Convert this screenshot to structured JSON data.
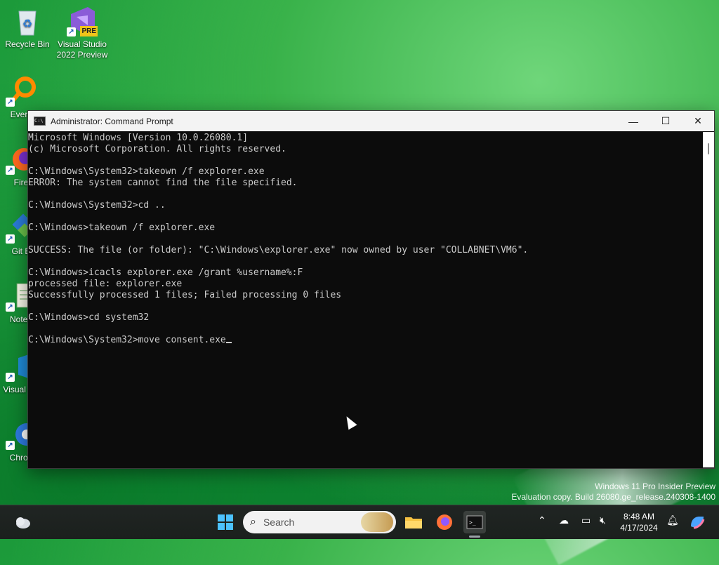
{
  "desktop": {
    "icons": [
      {
        "label": "Recycle Bin"
      },
      {
        "label": "Visual Studio 2022 Preview",
        "badge": "PRE"
      },
      {
        "label": "Every"
      },
      {
        "label": "Fire"
      },
      {
        "label": "Git E"
      },
      {
        "label": "Notep"
      },
      {
        "label": "Visual Co"
      },
      {
        "label": "Chron"
      }
    ],
    "watermark_line1": "Windows 11 Pro Insider Preview",
    "watermark_line2": "Evaluation copy. Build 26080.ge_release.240308-1400"
  },
  "window": {
    "title": "Administrator: Command Prompt",
    "icon_text": "C:\\",
    "minimize_glyph": "—",
    "maximize_glyph": "☐",
    "close_glyph": "✕",
    "console_lines": [
      "Microsoft Windows [Version 10.0.26080.1]",
      "(c) Microsoft Corporation. All rights reserved.",
      "",
      "C:\\Windows\\System32>takeown /f explorer.exe",
      "ERROR: The system cannot find the file specified.",
      "",
      "C:\\Windows\\System32>cd ..",
      "",
      "C:\\Windows>takeown /f explorer.exe",
      "",
      "SUCCESS: The file (or folder): \"C:\\Windows\\explorer.exe\" now owned by user \"COLLABNET\\VM6\".",
      "",
      "C:\\Windows>icacls explorer.exe /grant %username%:F",
      "processed file: explorer.exe",
      "Successfully processed 1 files; Failed processing 0 files",
      "",
      "C:\\Windows>cd system32",
      "",
      "C:\\Windows\\System32>move consent.exe"
    ]
  },
  "taskbar": {
    "search_placeholder": "Search",
    "search_icon": "search-icon",
    "time": "8:48 AM",
    "date": "4/17/2024",
    "apps": [
      "start-icon",
      "file-explorer-icon",
      "firefox-icon",
      "terminal-icon"
    ],
    "tray": [
      "chevron-up-icon",
      "onedrive-icon",
      "display-icon",
      "speaker-muted-icon",
      "notification-bell-icon",
      "copilot-icon"
    ]
  },
  "colors": {
    "console_bg": "#0c0c0c",
    "console_fg": "#cccccc",
    "titlebar_bg": "#f3f3f3",
    "taskbar_bg": "#1f2320",
    "desktop_green": "#23a542"
  }
}
